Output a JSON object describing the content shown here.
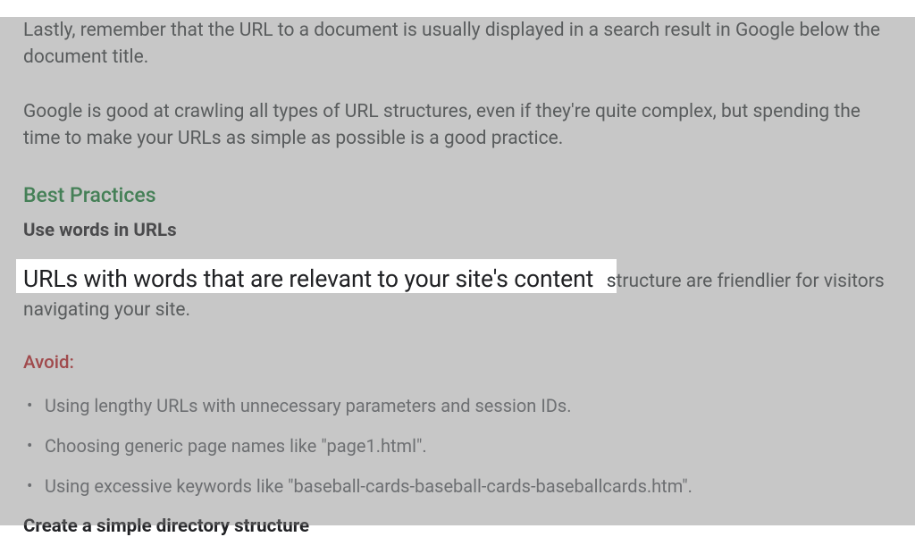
{
  "intro": {
    "para1": "Lastly, remember that the URL to a document is usually displayed in a search result in Google below the document title.",
    "para2": "Google is good at crawling all types of URL structures, even if they're quite complex, but spending the time to make your URLs as simple as possible is a good practice."
  },
  "bestPractices": {
    "heading": "Best Practices",
    "sub1": "Use words in URLs",
    "highlighted": "URLs with words that are relevant to your site's content ",
    "rest": "structure are friendlier for visitors navigating your site.",
    "avoidHeading": "Avoid:",
    "avoidItems": [
      "Using lengthy URLs with unnecessary parameters and session IDs.",
      "Choosing generic page names like \"page1.html\".",
      "Using excessive keywords like \"baseball-cards-baseball-cards-baseballcards.htm\"."
    ],
    "sub2": "Create a simple directory structure"
  }
}
